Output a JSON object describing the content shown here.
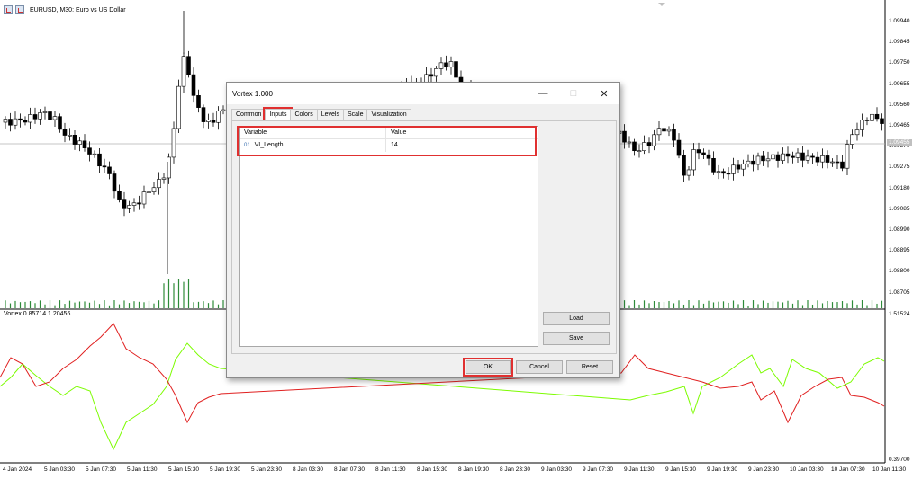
{
  "chart": {
    "title": "EURUSD, M30:  Euro vs US Dollar",
    "indicator_label": "Vortex 0.85714 1.20456",
    "current_price_label": "1.09455",
    "price_axis": [
      "1.09940",
      "1.09845",
      "1.09750",
      "1.09655",
      "1.09560",
      "1.09465",
      "1.09370",
      "1.09275",
      "1.09180",
      "1.09085",
      "1.08990",
      "1.08895",
      "1.08800",
      "1.08705"
    ],
    "indicator_axis": [
      "1.51524",
      "0.39700"
    ],
    "time_axis": [
      "4 Jan 2024",
      "5 Jan 03:30",
      "5 Jan 07:30",
      "5 Jan 11:30",
      "5 Jan 15:30",
      "5 Jan 19:30",
      "5 Jan 23:30",
      "8 Jan 03:30",
      "8 Jan 07:30",
      "8 Jan 11:30",
      "8 Jan 15:30",
      "8 Jan 19:30",
      "8 Jan 23:30",
      "9 Jan 03:30",
      "9 Jan 07:30",
      "9 Jan 11:30",
      "9 Jan 15:30",
      "9 Jan 19:30",
      "9 Jan 23:30",
      "10 Jan 03:30",
      "10 Jan 07:30",
      "10 Jan 11:30"
    ],
    "colors": {
      "vi_plus": "#7cfc00",
      "vi_minus": "#e02020",
      "volume": "#2e8b3a",
      "candle": "#000000"
    }
  },
  "dialog": {
    "title": "Vortex 1.000",
    "tabs": [
      "Common",
      "Inputs",
      "Colors",
      "Levels",
      "Scale",
      "Visualization"
    ],
    "active_tab": "Inputs",
    "grid": {
      "headers": [
        "Variable",
        "Value"
      ],
      "rows": [
        {
          "icon": "01",
          "variable": "VI_Length",
          "value": "14"
        }
      ]
    },
    "buttons": {
      "load": "Load",
      "save": "Save",
      "ok": "OK",
      "cancel": "Cancel",
      "reset": "Reset"
    }
  }
}
